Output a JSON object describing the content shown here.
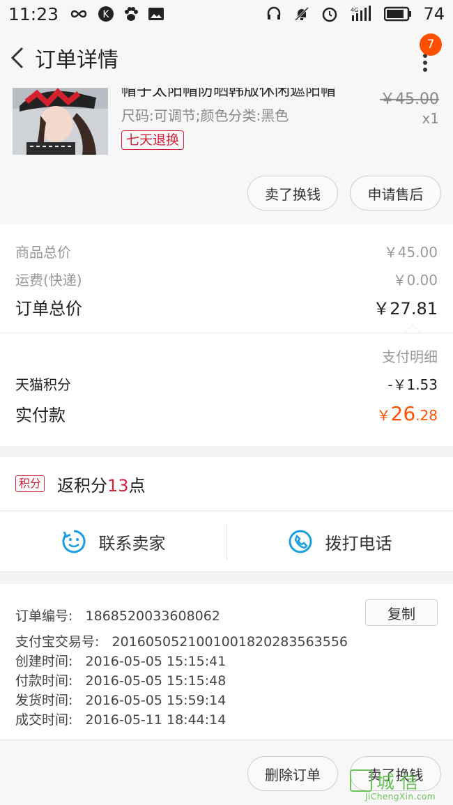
{
  "status_bar": {
    "time": "11:23",
    "battery": "74",
    "network": "4G"
  },
  "header": {
    "title": "订单详情",
    "badge_count": "7"
  },
  "product": {
    "title": "帽子太阳帽防晒韩版休闲遮阳帽",
    "sku": "尺码:可调节;颜色分类:黑色",
    "tag": "七天退换",
    "original_price": "￥45.00",
    "quantity": "x1",
    "buttons": {
      "sell": "卖了换钱",
      "after_sale": "申请售后"
    }
  },
  "price_summary": {
    "goods_total_label": "商品总价",
    "goods_total_value": "￥45.00",
    "shipping_label": "运费(快递)",
    "shipping_value": "￥0.00",
    "order_total_label": "订单总价",
    "order_total_value": "￥27.81",
    "payment_detail_label": "支付明细",
    "tmall_points_label": "天猫积分",
    "tmall_points_value": "-￥1.53",
    "paid_label": "实付款",
    "paid_currency": "￥",
    "paid_integer": "26",
    "paid_decimal": ".28"
  },
  "points": {
    "tag": "积分",
    "text_prefix": "返积分",
    "number": "13",
    "text_suffix": "点"
  },
  "contact": {
    "seller": "联系卖家",
    "call": "拨打电话"
  },
  "order_info": {
    "order_no_label": "订单编号:",
    "order_no": "1868520033608062",
    "copy_label": "复制",
    "alipay_label": "支付宝交易号:",
    "alipay_no": "2016050521001001820283563556",
    "created_label": "创建时间:",
    "created": "2016-05-05 15:15:41",
    "paid_label": "付款时间:",
    "paid": "2016-05-05 15:15:48",
    "shipped_label": "发货时间:",
    "shipped": "2016-05-05 15:59:14",
    "completed_label": "成交时间:",
    "completed": "2016-05-11 18:44:14"
  },
  "bottom_actions": {
    "delete": "删除订单",
    "sell": "卖了换钱"
  },
  "watermark": {
    "cn": "城 信",
    "en": "JiChengXin.com"
  },
  "colors": {
    "accent": "#ff5000",
    "red": "#d2233a",
    "blue": "#1a9ee0"
  }
}
